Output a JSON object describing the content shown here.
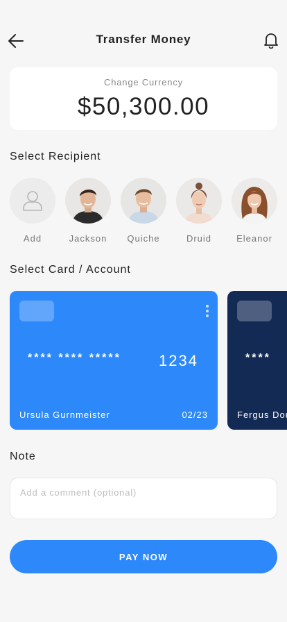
{
  "header": {
    "title": "Transfer Money",
    "back_icon": "arrow-left-icon",
    "bell_icon": "bell-icon"
  },
  "amount": {
    "label": "Change Currency",
    "value": "$50,300.00"
  },
  "recipients": {
    "title": "Select Recipient",
    "items": [
      {
        "name": "Add",
        "icon": "add-user-icon"
      },
      {
        "name": "Jackson"
      },
      {
        "name": "Quiche"
      },
      {
        "name": "Druid"
      },
      {
        "name": "Eleanor"
      }
    ]
  },
  "cards": {
    "title": "Select Card / Account",
    "items": [
      {
        "masked": "****  ****  *****",
        "last4": "1234",
        "holder": "Ursula Gurnmeister",
        "expiry": "02/23",
        "color": "#2d89fa"
      },
      {
        "masked": "****",
        "holder": "Fergus Dou",
        "color": "#132a55"
      }
    ]
  },
  "note": {
    "title": "Note",
    "placeholder": "Add a comment (optional)",
    "value": ""
  },
  "pay_button": {
    "label": "PAY NOW",
    "color": "#2d89fa"
  }
}
